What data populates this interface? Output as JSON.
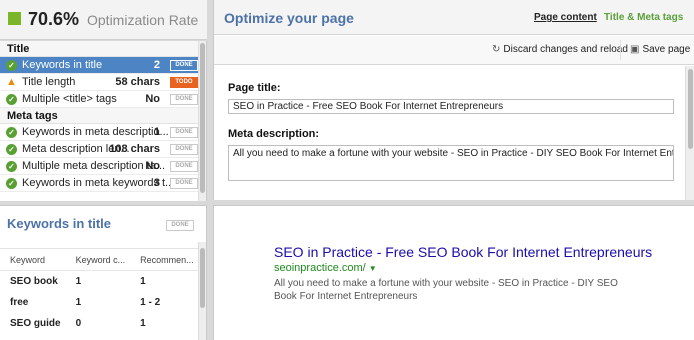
{
  "rate": {
    "value": "70.6%",
    "label": "Optimization Rate",
    "color": "#7ab52a"
  },
  "checks": {
    "title_section": "Title",
    "meta_section": "Meta tags",
    "rows": [
      {
        "label": "Keywords in title",
        "value": "2",
        "status": "DONE",
        "icon": "check-icon"
      },
      {
        "label": "Title length",
        "value": "58 chars",
        "status": "TODO",
        "icon": "warning-icon"
      },
      {
        "label": "Multiple <title> tags",
        "value": "No",
        "status": "DONE",
        "icon": "check-icon"
      },
      {
        "label": "Keywords in meta descriptio...",
        "value": "1",
        "status": "DONE",
        "icon": "check-icon"
      },
      {
        "label": "Meta description len...",
        "value": "108 chars",
        "status": "DONE",
        "icon": "check-icon"
      },
      {
        "label": "Multiple meta description ta...",
        "value": "No",
        "status": "DONE",
        "icon": "check-icon"
      },
      {
        "label": "Keywords in meta keywords t...",
        "value": "3",
        "status": "DONE",
        "icon": "check-icon"
      }
    ]
  },
  "keywords_panel": {
    "title": "Keywords in title",
    "badge": "DONE",
    "columns": [
      "Keyword",
      "Keyword c...",
      "Recommen..."
    ],
    "rows": [
      [
        "SEO book",
        "1",
        "1"
      ],
      [
        "free",
        "1",
        "1 - 2"
      ],
      [
        "SEO guide",
        "0",
        "1"
      ]
    ]
  },
  "main": {
    "title": "Optimize your page",
    "tab_content": "Page content",
    "tab_meta": "Title & Meta tags",
    "discard_label": "Discard changes and reload",
    "save_label": "Save page",
    "page_title_label": "Page title:",
    "page_title_value": "SEO in Practice - Free SEO Book For Internet Entrepreneurs",
    "meta_desc_label": "Meta description:",
    "meta_desc_value": "All you need to make a fortune with your website - SEO in Practice - DIY SEO Book For Internet Entrepreneurs"
  },
  "preview": {
    "title": "SEO in Practice - Free SEO Book For Internet Entrepreneurs",
    "url": "seoinpractice.com/",
    "description": "All you need to make a fortune with your website - SEO in Practice - DIY SEO Book For Internet Entrepreneurs"
  }
}
